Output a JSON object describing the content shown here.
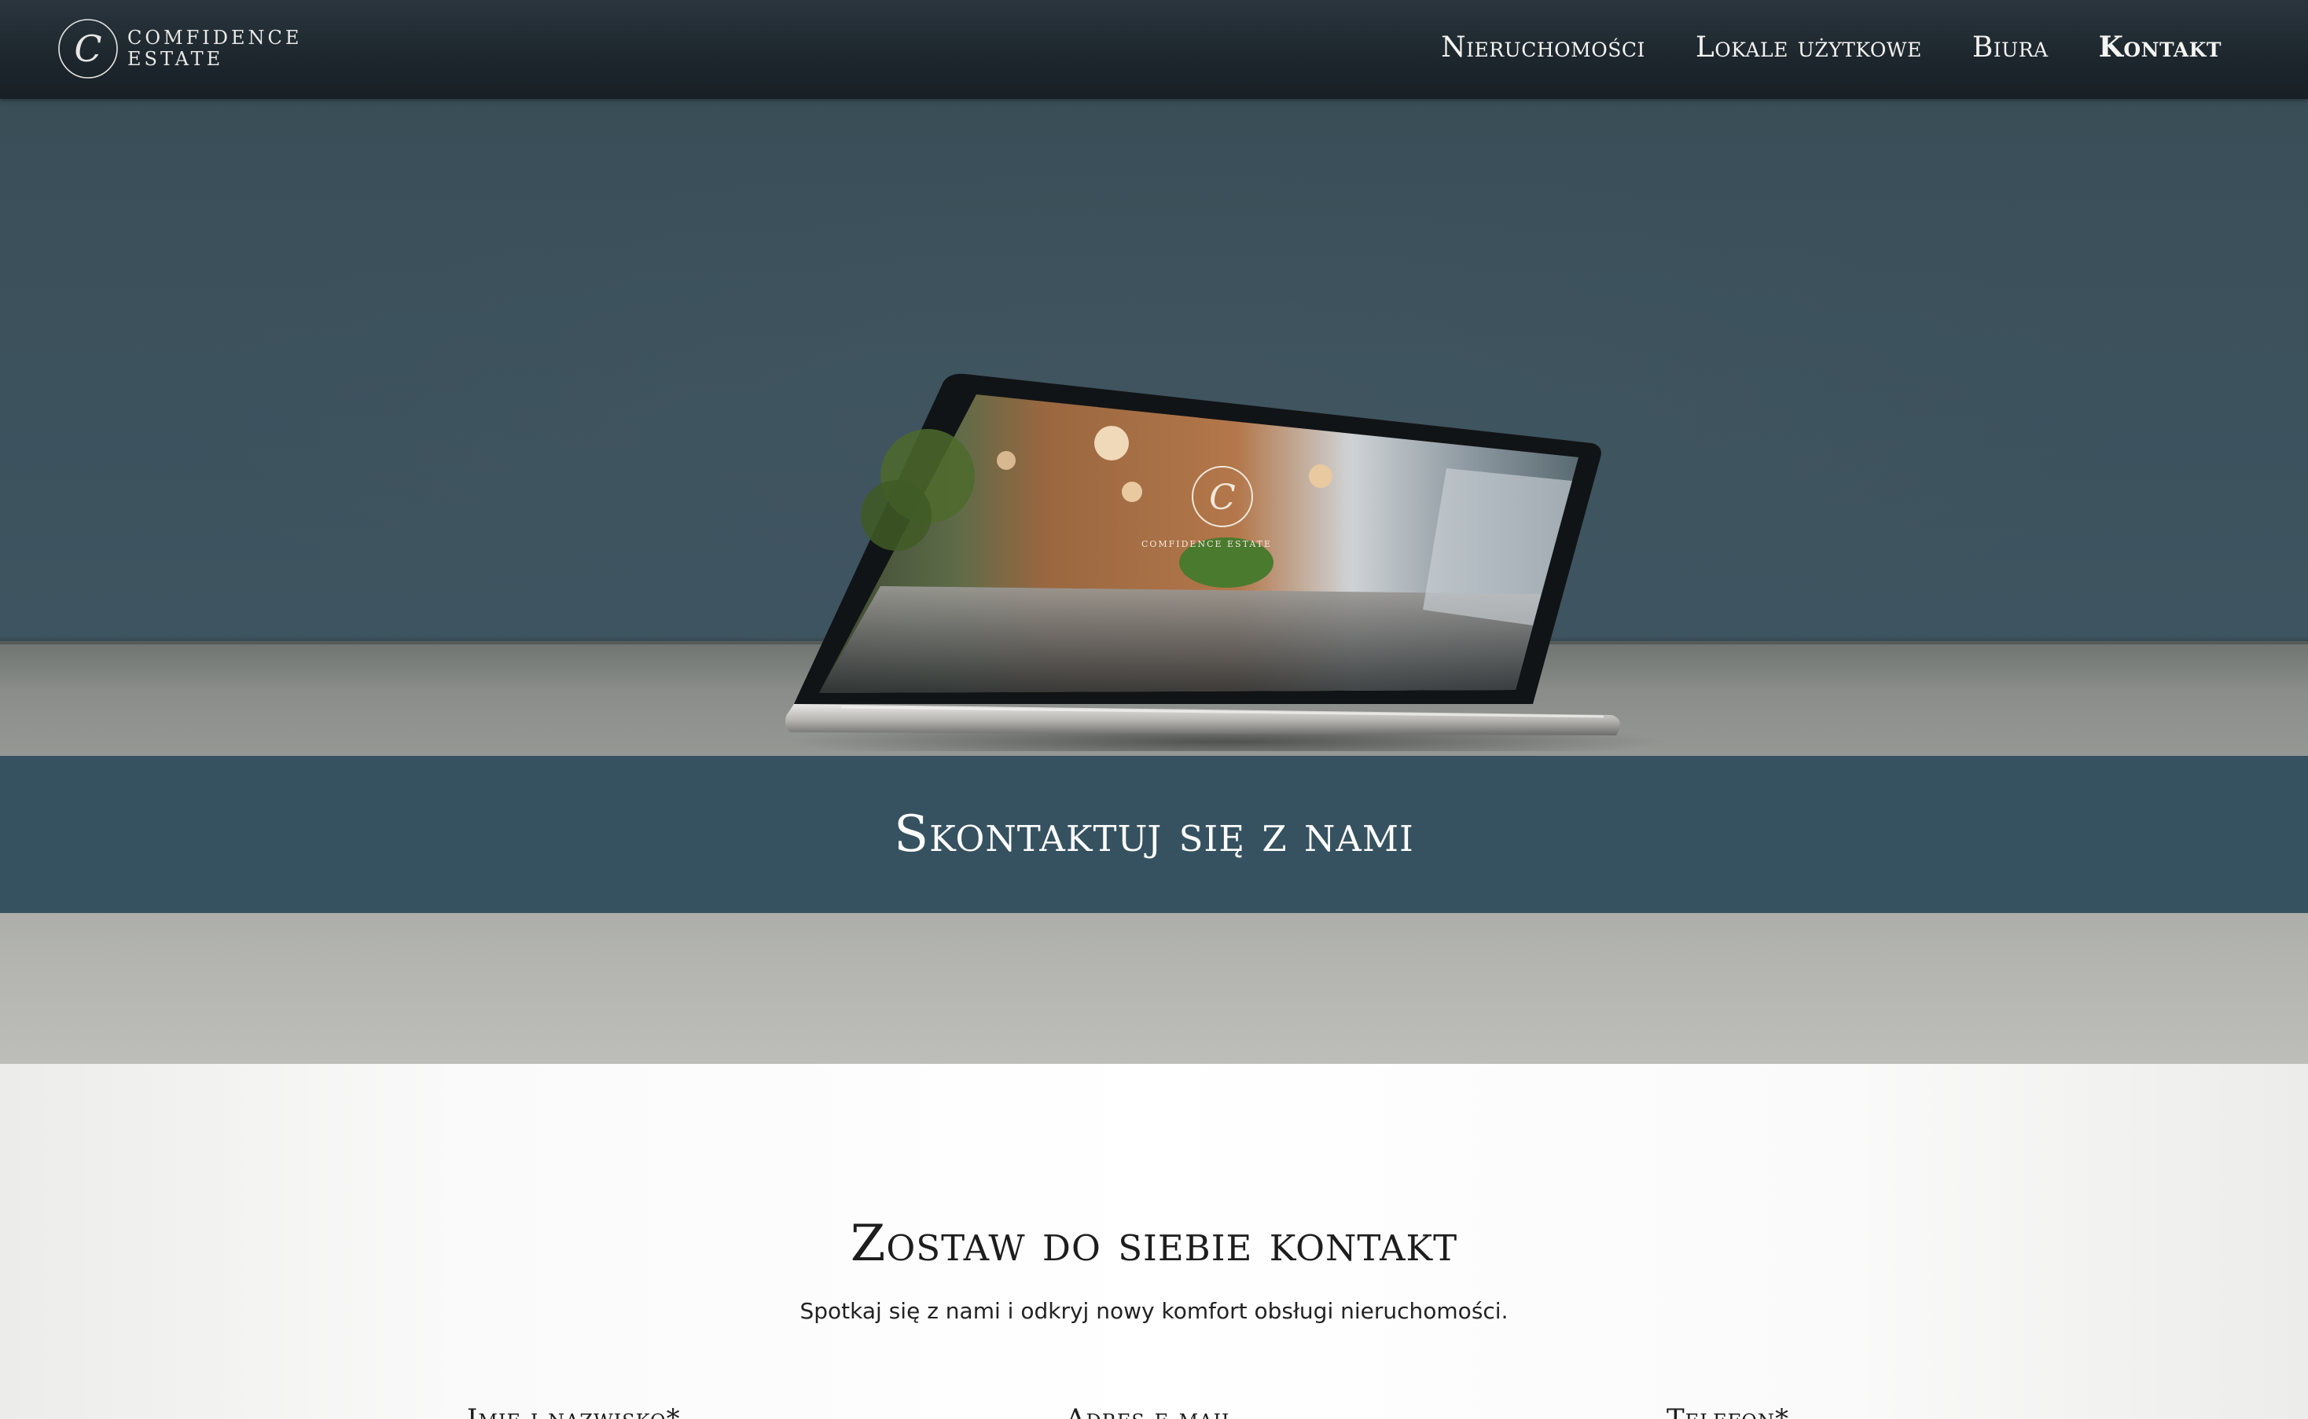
{
  "brand": {
    "logo_letter": "C",
    "line1": "COMFIDENCE",
    "line2": "ESTATE"
  },
  "nav": {
    "items": [
      {
        "label": "Nieruchomości",
        "active": false
      },
      {
        "label": "Lokale użytkowe",
        "active": false
      },
      {
        "label": "Biura",
        "active": false
      },
      {
        "label": "Kontakt",
        "active": true
      }
    ]
  },
  "hero": {
    "banner_title": "Skontaktuj się z nami",
    "screen_logo_text": "COMFIDENCE ESTATE"
  },
  "contact": {
    "title": "Zostaw do siebie kontakt",
    "subtitle": "Spotkaj się z nami i odkryj nowy komfort obsługi nieruchomości.",
    "fields": {
      "name_label": "Imię i nazwisko*",
      "email_label": "Adres e-mail",
      "phone_label": "Telefon*"
    }
  },
  "colors": {
    "header_bg": "#1d262d",
    "banner_bg": "#365260",
    "wall": "#3c525d",
    "text_dark": "#1d1d1d"
  }
}
